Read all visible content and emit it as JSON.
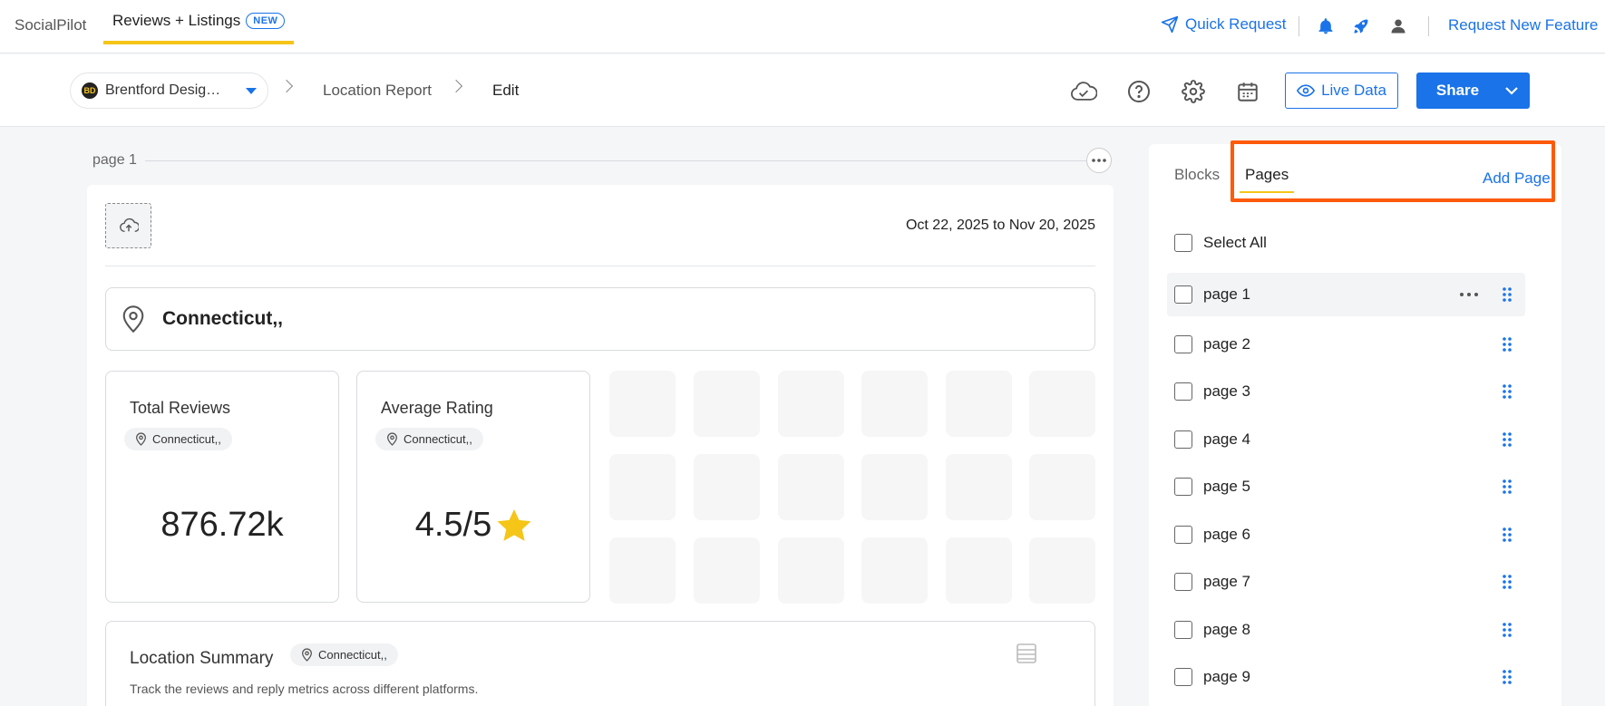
{
  "topnav": {
    "brand": "SocialPilot",
    "active_tab": "Reviews + Listings",
    "new_badge": "NEW",
    "quick_request": "Quick Request",
    "request_feature": "Request New Feature"
  },
  "toolbar": {
    "location": "Brentford Desig…",
    "logo_text": "BD",
    "breadcrumbs": [
      "Location Report",
      "Edit"
    ],
    "live_data": "Live Data",
    "share": "Share"
  },
  "canvas": {
    "page_label": "page 1",
    "date_range": "Oct 22, 2025 to Nov 20, 2025",
    "location_title": "Connecticut,,",
    "metrics": [
      {
        "title": "Total Reviews",
        "chip": "Connecticut,,",
        "value": "876.72k"
      },
      {
        "title": "Average Rating",
        "chip": "Connecticut,,",
        "value": "4.5/5"
      }
    ],
    "summary": {
      "title": "Location Summary",
      "chip": "Connecticut,,",
      "description": "Track the reviews and reply metrics across different platforms."
    }
  },
  "panel": {
    "tabs": [
      "Blocks",
      "Pages"
    ],
    "add_page": "Add Page",
    "select_all": "Select All",
    "pages": [
      "page 1",
      "page 2",
      "page 3",
      "page 4",
      "page 5",
      "page 6",
      "page 7",
      "page 8",
      "page 9"
    ]
  },
  "colors": {
    "accent": "#1a73e8",
    "tab_underline": "#f5c518",
    "highlight": "#ff5a0a",
    "star": "#f5c518"
  }
}
